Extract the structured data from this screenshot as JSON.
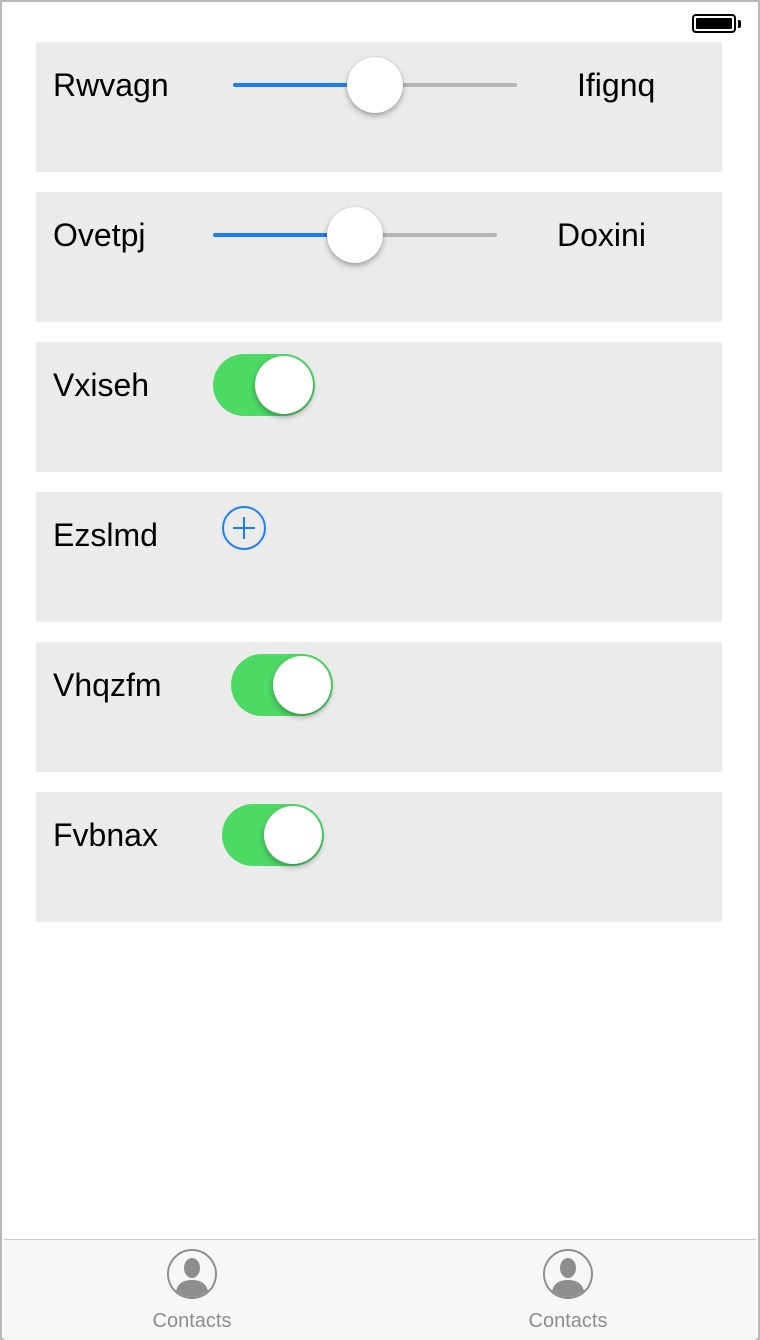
{
  "rows": [
    {
      "label": "Rwvagn",
      "type": "slider",
      "value_fraction": 0.5,
      "right_label": "Ifignq"
    },
    {
      "label": "Ovetpj",
      "type": "slider",
      "value_fraction": 0.5,
      "right_label": "Doxini"
    },
    {
      "label": "Vxiseh",
      "type": "toggle",
      "on": true
    },
    {
      "label": "Ezslmd",
      "type": "add-button",
      "icon": "plus-circle-icon"
    },
    {
      "label": "Vhqzfm",
      "type": "toggle",
      "on": true
    },
    {
      "label": "Fvbnax",
      "type": "toggle",
      "on": true
    }
  ],
  "tabbar": {
    "tabs": [
      {
        "label": "Contacts",
        "icon": "contacts-icon"
      },
      {
        "label": "Contacts",
        "icon": "contacts-icon"
      }
    ]
  },
  "colors": {
    "accent": "#1a7ff5",
    "toggle_on": "#4cd964",
    "row_background": "#ebebeb",
    "tab_inactive": "#8e8e8e"
  }
}
